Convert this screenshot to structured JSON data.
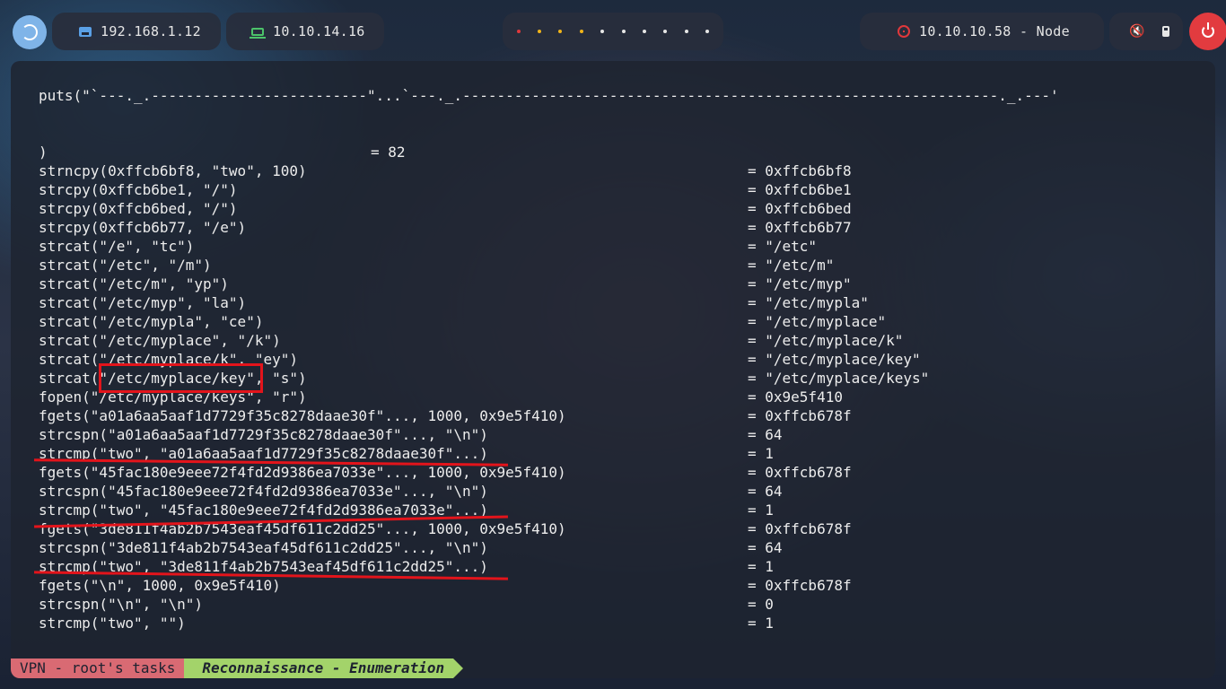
{
  "topbar": {
    "local_ip": "192.168.1.12",
    "vpn_ip": "10.10.14.16",
    "workspace_dots": [
      "#e0383b",
      "#f0b419",
      "#f0b419",
      "#f0b419",
      "#e6e6e6",
      "#e6e6e6",
      "#e6e6e6",
      "#e6e6e6",
      "#e6e6e6",
      "#e6e6e6"
    ],
    "target": "10.10.10.58 - Node",
    "icons": {
      "logo": "debian-logo-icon",
      "local": "ethernet-icon",
      "vpn": "laptop-icon",
      "target": "target-icon",
      "volume": "mute-icon",
      "battery": "battery-icon",
      "power": "power-icon"
    },
    "colors": {
      "accent_blue": "#7fb4e8",
      "green": "#4cc36a",
      "red": "#e23b3f"
    }
  },
  "terminal": {
    "lines": [
      {
        "left": "puts(\"`---._.-------------------------\"...`---._.--------------------------------------------------------------._.---'",
        "right": ""
      },
      {
        "left": "",
        "right": ""
      },
      {
        "left": "",
        "right": ""
      },
      {
        "left": ")",
        "right": "= 82",
        "mid": true
      },
      {
        "left": "strncpy(0xffcb6bf8, \"two\", 100)",
        "right": "= 0xffcb6bf8"
      },
      {
        "left": "strcpy(0xffcb6be1, \"/\")",
        "right": "= 0xffcb6be1"
      },
      {
        "left": "strcpy(0xffcb6bed, \"/\")",
        "right": "= 0xffcb6bed"
      },
      {
        "left": "strcpy(0xffcb6b77, \"/e\")",
        "right": "= 0xffcb6b77"
      },
      {
        "left": "strcat(\"/e\", \"tc\")",
        "right": "= \"/etc\""
      },
      {
        "left": "strcat(\"/etc\", \"/m\")",
        "right": "= \"/etc/m\""
      },
      {
        "left": "strcat(\"/etc/m\", \"yp\")",
        "right": "= \"/etc/myp\""
      },
      {
        "left": "strcat(\"/etc/myp\", \"la\")",
        "right": "= \"/etc/mypla\""
      },
      {
        "left": "strcat(\"/etc/mypla\", \"ce\")",
        "right": "= \"/etc/myplace\""
      },
      {
        "left": "strcat(\"/etc/myplace\", \"/k\")",
        "right": "= \"/etc/myplace/k\""
      },
      {
        "left": "strcat(\"/etc/myplace/k\", \"ey\")",
        "right": "= \"/etc/myplace/key\""
      },
      {
        "left": "strcat(\"/etc/myplace/key\", \"s\")",
        "right": "= \"/etc/myplace/keys\""
      },
      {
        "left": "fopen(\"/etc/myplace/keys\", \"r\")",
        "right": "= 0x9e5f410"
      },
      {
        "left": "fgets(\"a01a6aa5aaf1d7729f35c8278daae30f\"..., 1000, 0x9e5f410)",
        "right": "= 0xffcb678f"
      },
      {
        "left": "strcspn(\"a01a6aa5aaf1d7729f35c8278daae30f\"..., \"\\n\")",
        "right": "= 64"
      },
      {
        "left": "strcmp(\"two\", \"a01a6aa5aaf1d7729f35c8278daae30f\"...)",
        "right": "= 1"
      },
      {
        "left": "fgets(\"45fac180e9eee72f4fd2d9386ea7033e\"..., 1000, 0x9e5f410)",
        "right": "= 0xffcb678f"
      },
      {
        "left": "strcspn(\"45fac180e9eee72f4fd2d9386ea7033e\"..., \"\\n\")",
        "right": "= 64"
      },
      {
        "left": "strcmp(\"two\", \"45fac180e9eee72f4fd2d9386ea7033e\"...)",
        "right": "= 1"
      },
      {
        "left": "fgets(\"3de811f4ab2b7543eaf45df611c2dd25\"..., 1000, 0x9e5f410)",
        "right": "= 0xffcb678f"
      },
      {
        "left": "strcspn(\"3de811f4ab2b7543eaf45df611c2dd25\"..., \"\\n\")",
        "right": "= 64"
      },
      {
        "left": "strcmp(\"two\", \"3de811f4ab2b7543eaf45df611c2dd25\"...)",
        "right": "= 1"
      },
      {
        "left": "fgets(\"\\n\", 1000, 0x9e5f410)",
        "right": "= 0xffcb678f"
      },
      {
        "left": "strcspn(\"\\n\", \"\\n\")",
        "right": "= 0"
      },
      {
        "left": "strcmp(\"two\", \"\")",
        "right": "= 1"
      }
    ],
    "annotation_color": "#e3141b"
  },
  "statusbar": {
    "session": "VPN - root's tasks",
    "window": "Reconnaissance - Enumeration"
  }
}
